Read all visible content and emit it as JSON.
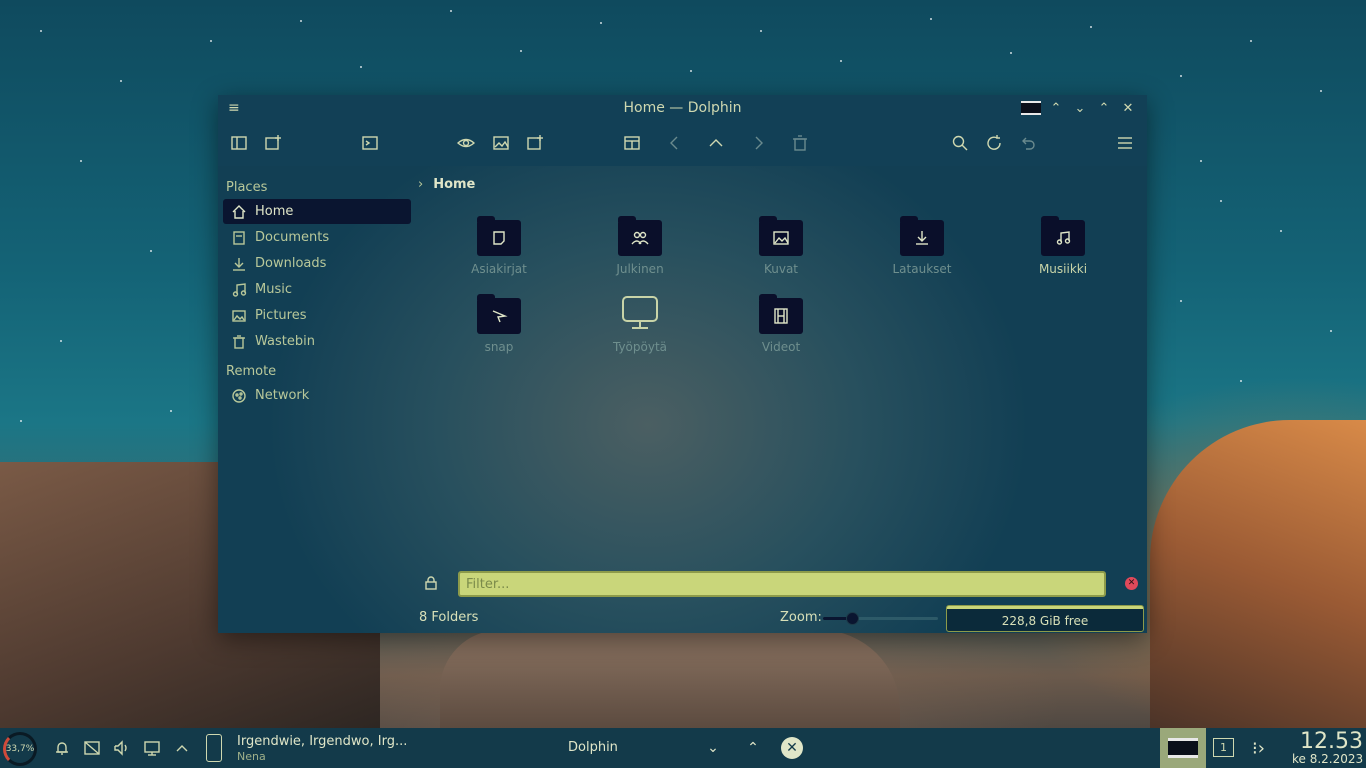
{
  "window": {
    "title": "Home — Dolphin"
  },
  "sidebar": {
    "places_title": "Places",
    "places": [
      {
        "label": "Home",
        "icon": "home-icon"
      },
      {
        "label": "Documents",
        "icon": "document-icon"
      },
      {
        "label": "Downloads",
        "icon": "download-icon"
      },
      {
        "label": "Music",
        "icon": "music-icon"
      },
      {
        "label": "Pictures",
        "icon": "picture-icon"
      },
      {
        "label": "Wastebin",
        "icon": "trash-icon"
      }
    ],
    "remote_title": "Remote",
    "remote": [
      {
        "label": "Network",
        "icon": "network-icon"
      }
    ]
  },
  "breadcrumb": {
    "current": "Home"
  },
  "files": [
    {
      "name": "Asiakirjat",
      "icon": "document-icon"
    },
    {
      "name": "Julkinen",
      "icon": "users-icon"
    },
    {
      "name": "Kuvat",
      "icon": "picture-icon"
    },
    {
      "name": "Lataukset",
      "icon": "download-icon"
    },
    {
      "name": "Musiikki",
      "icon": "music-icon"
    },
    {
      "name": "snap",
      "icon": "snap-icon"
    },
    {
      "name": "Työpöytä",
      "icon": "monitor-icon"
    },
    {
      "name": "Videot",
      "icon": "film-icon"
    }
  ],
  "filter": {
    "placeholder": "Filter..."
  },
  "status": {
    "count": "8 Folders",
    "zoom_label": "Zoom:",
    "zoom_level": 0.25,
    "free_space": "228,8 GiB free"
  },
  "taskbar": {
    "cpu": "33,7%",
    "media_title": "Irgendwie, Irgendwo, Irg...",
    "media_artist": "Nena",
    "task_name": "Dolphin",
    "desktop_number": "1",
    "time": "12.53",
    "date": "ke 8.2.2023"
  },
  "colors": {
    "accent": "#c9d67a",
    "selection": "#0a1530",
    "titlebar": "#124056",
    "taskbar": "#133a4a"
  }
}
